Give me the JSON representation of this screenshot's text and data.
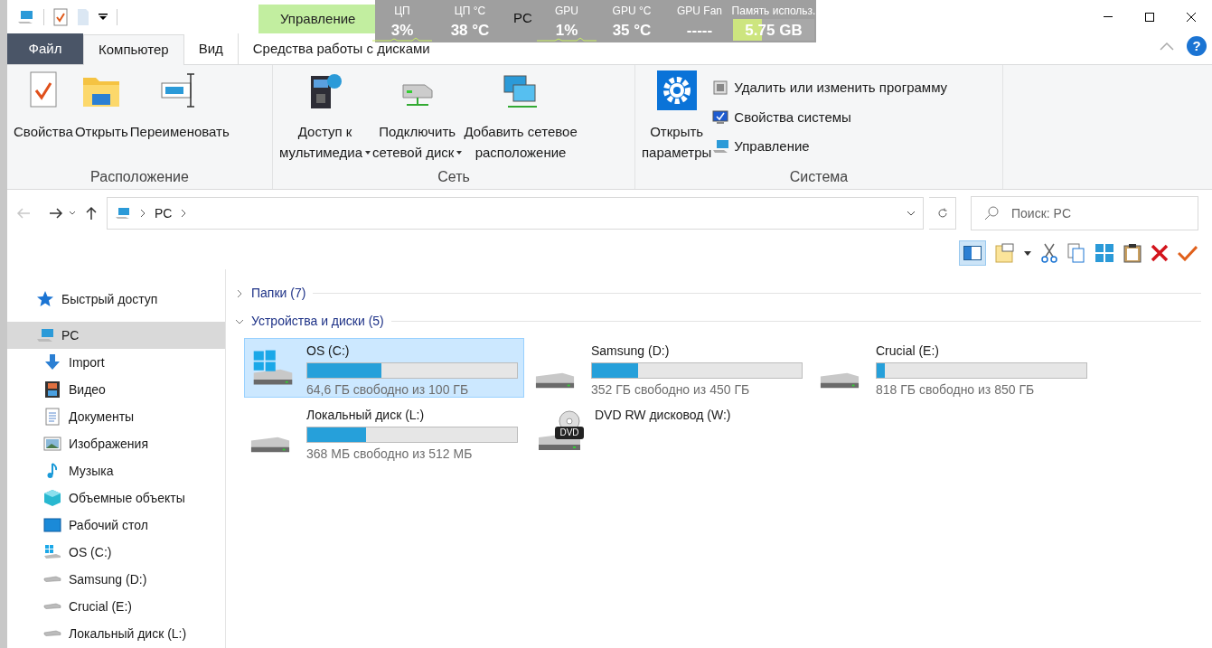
{
  "window": {
    "title": "PC",
    "contextual_group": "Управление",
    "help": "?"
  },
  "hw_monitor": [
    {
      "label": "ЦП",
      "value": "3%",
      "kind": "graph"
    },
    {
      "label": "ЦП °C",
      "value": "38 °C",
      "kind": "plain"
    },
    {
      "label": "GPU",
      "value": "1%",
      "kind": "graph"
    },
    {
      "label": "GPU °C",
      "value": "35 °C",
      "kind": "plain"
    },
    {
      "label": "GPU Fan",
      "value": "-----",
      "kind": "plain"
    },
    {
      "label": "Память использ.",
      "value": "5.75 GB",
      "kind": "meter",
      "level": 0.35
    }
  ],
  "ribbon_tabs": [
    {
      "label": "Файл",
      "kind": "file",
      "selected": false
    },
    {
      "label": "Компьютер",
      "kind": "tab",
      "selected": true
    },
    {
      "label": "Вид",
      "kind": "tab",
      "selected": false
    },
    {
      "label": "Средства работы с дисками",
      "kind": "contextual",
      "selected": false
    }
  ],
  "ribbon_groups": [
    {
      "label": "Расположение",
      "items": [
        {
          "kind": "large",
          "lines": [
            "Свойства"
          ],
          "dropdown": false
        },
        {
          "kind": "large",
          "lines": [
            "Открыть"
          ],
          "dropdown": false
        },
        {
          "kind": "large",
          "lines": [
            "Переименовать"
          ],
          "dropdown": false
        }
      ]
    },
    {
      "label": "Сеть",
      "items": [
        {
          "kind": "large",
          "lines": [
            "Доступ к",
            "мультимедиа"
          ],
          "dropdown": true
        },
        {
          "kind": "large",
          "lines": [
            "Подключить",
            "сетевой диск"
          ],
          "dropdown": true
        },
        {
          "kind": "large",
          "lines": [
            "Добавить сетевое",
            "расположение"
          ],
          "dropdown": false
        }
      ]
    },
    {
      "label": "Система",
      "items": [
        {
          "kind": "large",
          "lines": [
            "Открыть",
            "параметры"
          ],
          "dropdown": false
        },
        {
          "kind": "stack",
          "entries": [
            {
              "label": "Удалить или изменить программу"
            },
            {
              "label": "Свойства системы"
            },
            {
              "label": "Управление"
            }
          ]
        }
      ]
    }
  ],
  "address": {
    "path": [
      "PC"
    ],
    "search_placeholder": "Поиск: PC"
  },
  "navigation": [
    {
      "label": "Быстрый доступ",
      "kind": "star",
      "selected": false
    },
    {
      "label": "PC",
      "kind": "pc",
      "selected": true,
      "children": [
        {
          "label": "Import",
          "kind": "download",
          "selected": false
        },
        {
          "label": "Видео",
          "kind": "video",
          "selected": false
        },
        {
          "label": "Документы",
          "kind": "docs",
          "selected": false
        },
        {
          "label": "Изображения",
          "kind": "images",
          "selected": false
        },
        {
          "label": "Музыка",
          "kind": "music",
          "selected": false
        },
        {
          "label": "Объемные объекты",
          "kind": "cube",
          "selected": false
        },
        {
          "label": "Рабочий стол",
          "kind": "desktop",
          "selected": false
        },
        {
          "label": "OS (C:)",
          "kind": "osdrive",
          "selected": false
        },
        {
          "label": "Samsung (D:)",
          "kind": "drive",
          "selected": false
        },
        {
          "label": "Crucial (E:)",
          "kind": "drive",
          "selected": false
        },
        {
          "label": "Локальный диск (L:)",
          "kind": "drive",
          "selected": false
        }
      ]
    }
  ],
  "sections": [
    {
      "label": "Папки (7)",
      "expanded": false
    },
    {
      "label": "Устройства и диски (5)",
      "expanded": true,
      "drives": [
        {
          "name": "OS (C:)",
          "kind": "os",
          "level": 0.354,
          "free": "64,6 ГБ свободно из 100 ГБ",
          "selected": true
        },
        {
          "name": "Samsung (D:)",
          "kind": "hdd",
          "level": 0.22,
          "free": "352 ГБ свободно из 450 ГБ",
          "selected": false
        },
        {
          "name": "Crucial (E:)",
          "kind": "hdd",
          "level": 0.04,
          "free": "818 ГБ свободно из 850 ГБ",
          "selected": false
        },
        {
          "name": "Локальный диск (L:)",
          "kind": "hdd",
          "level": 0.28,
          "free": "368 МБ свободно из 512 МБ",
          "selected": false
        },
        {
          "name": "DVD RW дисковод (W:)",
          "kind": "dvd",
          "badge": "DVD",
          "selected": false
        }
      ]
    }
  ]
}
